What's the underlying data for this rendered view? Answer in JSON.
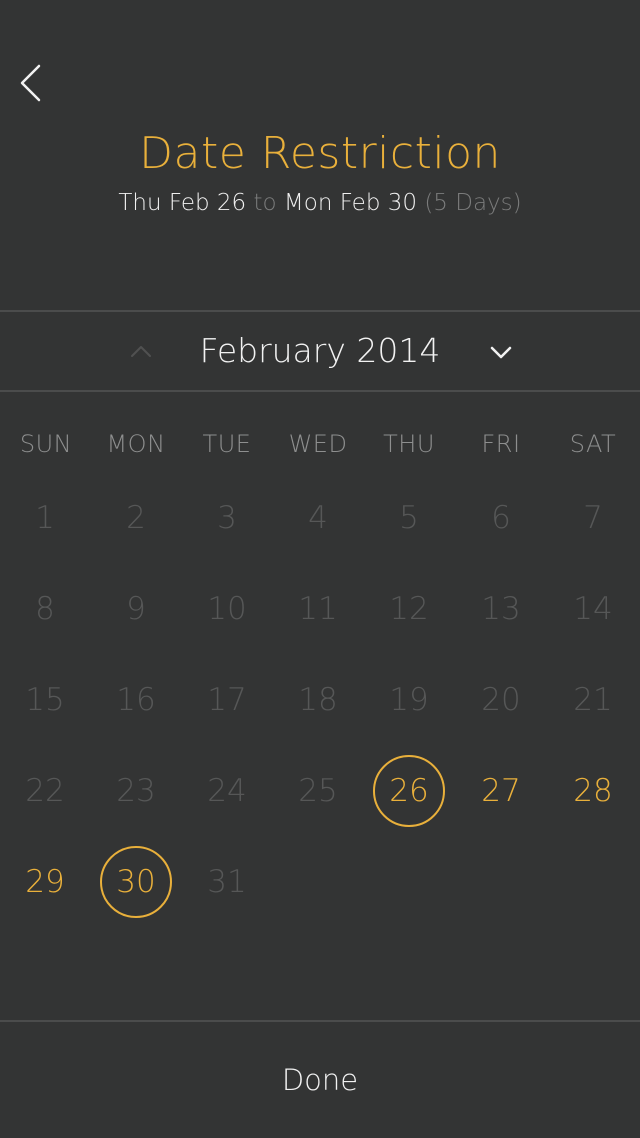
{
  "header": {
    "title": "Date Restriction",
    "range_start": "Thu Feb 26",
    "range_connector": "to",
    "range_end": "Mon Feb 30",
    "range_length": "(5 Days)"
  },
  "calendar": {
    "month_label": "February 2014",
    "weekdays": [
      "SUN",
      "MON",
      "TUE",
      "WED",
      "THU",
      "FRI",
      "SAT"
    ],
    "weeks": [
      [
        {
          "label": "1",
          "state": "disabled"
        },
        {
          "label": "2",
          "state": "disabled"
        },
        {
          "label": "3",
          "state": "disabled"
        },
        {
          "label": "4",
          "state": "disabled"
        },
        {
          "label": "5",
          "state": "disabled"
        },
        {
          "label": "6",
          "state": "disabled"
        },
        {
          "label": "7",
          "state": "disabled"
        }
      ],
      [
        {
          "label": "8",
          "state": "disabled"
        },
        {
          "label": "9",
          "state": "disabled"
        },
        {
          "label": "10",
          "state": "disabled"
        },
        {
          "label": "11",
          "state": "disabled"
        },
        {
          "label": "12",
          "state": "disabled"
        },
        {
          "label": "13",
          "state": "disabled"
        },
        {
          "label": "14",
          "state": "disabled"
        }
      ],
      [
        {
          "label": "15",
          "state": "disabled"
        },
        {
          "label": "16",
          "state": "disabled"
        },
        {
          "label": "17",
          "state": "disabled"
        },
        {
          "label": "18",
          "state": "disabled"
        },
        {
          "label": "19",
          "state": "disabled"
        },
        {
          "label": "20",
          "state": "disabled"
        },
        {
          "label": "21",
          "state": "disabled"
        }
      ],
      [
        {
          "label": "22",
          "state": "disabled"
        },
        {
          "label": "23",
          "state": "disabled"
        },
        {
          "label": "24",
          "state": "disabled"
        },
        {
          "label": "25",
          "state": "disabled"
        },
        {
          "label": "26",
          "state": "selected"
        },
        {
          "label": "27",
          "state": "active"
        },
        {
          "label": "28",
          "state": "active"
        }
      ],
      [
        {
          "label": "29",
          "state": "active"
        },
        {
          "label": "30",
          "state": "selected"
        },
        {
          "label": "31",
          "state": "disabled"
        }
      ]
    ]
  },
  "footer": {
    "done_label": "Done"
  },
  "colors": {
    "background": "#333434",
    "accent": "#e9b03b",
    "disabled_text": "#565757",
    "muted_text": "#7b7c7c",
    "divider": "#4b4c4c"
  },
  "icons": {
    "back": "chevron-left-icon",
    "prev_month": "chevron-up-icon",
    "next_month": "chevron-down-icon"
  }
}
